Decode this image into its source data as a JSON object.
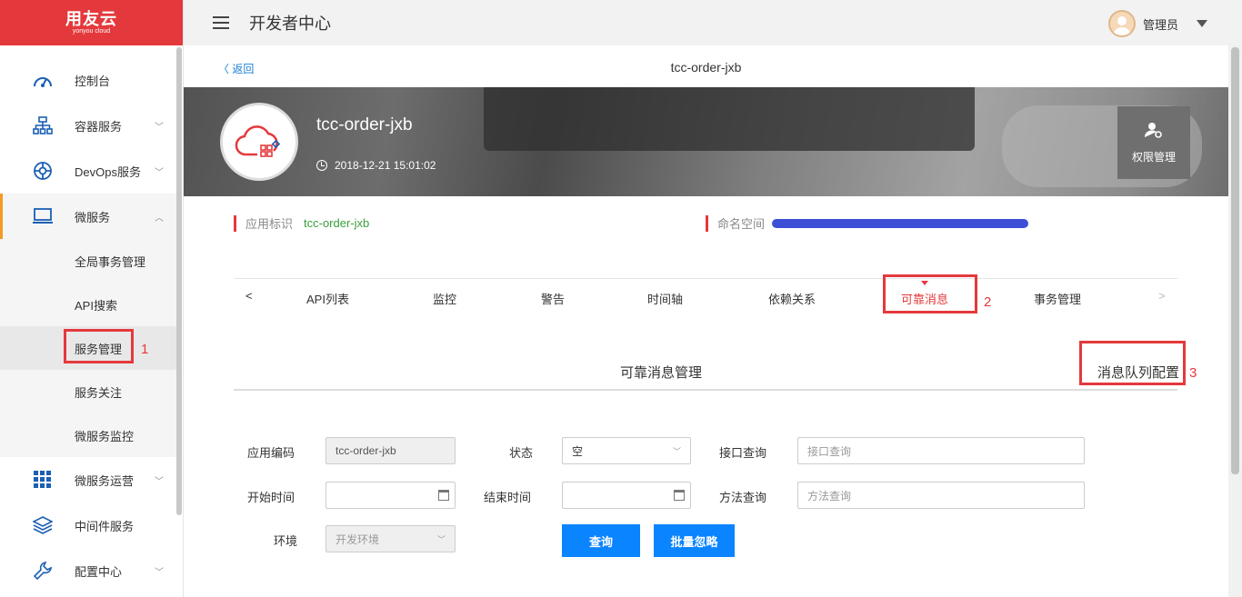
{
  "brand": {
    "name": "用友云",
    "sub": "yonyou cloud"
  },
  "topbar": {
    "title": "开发者中心",
    "user": "管理员"
  },
  "sidebar": {
    "items": [
      {
        "label": "控制台",
        "icon": "dashboard-icon"
      },
      {
        "label": "容器服务",
        "icon": "network-icon",
        "expandable": true
      },
      {
        "label": "DevOps服务",
        "icon": "devops-icon",
        "expandable": true
      },
      {
        "label": "微服务",
        "icon": "laptop-icon",
        "expandable": true,
        "expanded": true
      },
      {
        "label": "微服务运营",
        "icon": "grid-icon",
        "expandable": true
      },
      {
        "label": "中间件服务",
        "icon": "layers-icon"
      },
      {
        "label": "配置中心",
        "icon": "wrench-icon",
        "expandable": true
      }
    ],
    "submenu": [
      "全局事务管理",
      "API搜索",
      "服务管理",
      "服务关注",
      "微服务监控"
    ],
    "selected_sub": "服务管理"
  },
  "annotations": {
    "n1": "1",
    "n2": "2",
    "n3": "3"
  },
  "header": {
    "back": "返回",
    "title": "tcc-order-jxb"
  },
  "app": {
    "name": "tcc-order-jxb",
    "created": "2018-12-21 15:01:02",
    "perm_label": "权限管理"
  },
  "info": {
    "app_id_label": "应用标识",
    "app_id_value": "tcc-order-jxb",
    "namespace_label": "命名空间"
  },
  "tabs": {
    "prev": "<",
    "next": ">",
    "items": [
      "API列表",
      "监控",
      "警告",
      "时间轴",
      "依赖关系",
      "可靠消息",
      "事务管理"
    ],
    "active": "可靠消息"
  },
  "section": {
    "title": "可靠消息管理",
    "queue_config": "消息队列配置"
  },
  "form": {
    "app_code_label": "应用编码",
    "app_code_value": "tcc-order-jxb",
    "status_label": "状态",
    "status_value": "空",
    "api_query_label": "接口查询",
    "api_query_placeholder": "接口查询",
    "start_label": "开始时间",
    "end_label": "结束时间",
    "method_query_label": "方法查询",
    "method_query_placeholder": "方法查询",
    "env_label": "环境",
    "env_value": "开发环境",
    "query_btn": "查询",
    "ignore_btn": "批量忽略"
  },
  "colors": {
    "brand_red": "#e4393c",
    "primary_blue": "#0a84ff",
    "active_orange": "#f59a23"
  }
}
